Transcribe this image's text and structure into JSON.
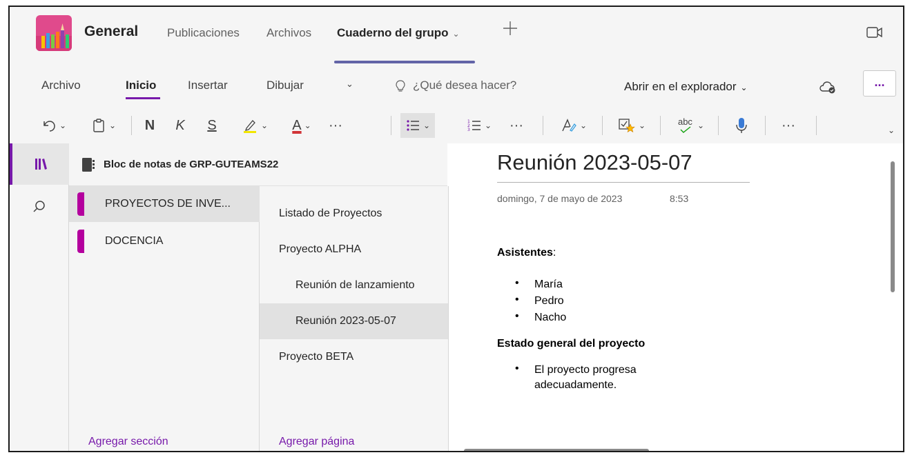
{
  "header": {
    "channel": "General",
    "tabs": [
      {
        "label": "Publicaciones"
      },
      {
        "label": "Archivos"
      },
      {
        "label": "Cuaderno del grupo",
        "active": true
      }
    ],
    "tab_dropdown_icon": "chevron-down-icon",
    "add_tab_icon": "plus-icon",
    "meet_icon": "video-camera-icon"
  },
  "ribbon": {
    "tabs": [
      "Archivo",
      "Inicio",
      "Insertar",
      "Dibujar"
    ],
    "active_tab": "Inicio",
    "tellme_placeholder": "¿Qué desea hacer?",
    "open_in_explorer": "Abrir en el explorador",
    "more_label": "...",
    "toolbar": {
      "bold": "N",
      "italic": "K",
      "underline": "S",
      "font_color_letter": "A",
      "more": "···",
      "spell_label": "abc",
      "highlight_color": "#f2e600",
      "font_color": "#d13438"
    }
  },
  "navigation": {
    "notebook_name": "Bloc de notas de GRP-GUTEAMS22",
    "sections": [
      {
        "label": "PROYECTOS DE INVE...",
        "color": "#b4009e",
        "selected": true
      },
      {
        "label": "DOCENCIA",
        "color": "#b4009e",
        "selected": false
      }
    ],
    "pages": [
      {
        "label": "Listado de Proyectos",
        "level": 0,
        "selected": false
      },
      {
        "label": "Proyecto ALPHA",
        "level": 0,
        "selected": false
      },
      {
        "label": "Reunión de lanzamiento",
        "level": 1,
        "selected": false
      },
      {
        "label": "Reunión 2023-05-07",
        "level": 1,
        "selected": true
      },
      {
        "label": "Proyecto BETA",
        "level": 0,
        "selected": false
      }
    ],
    "add_section": "Agregar sección",
    "add_page": "Agregar página"
  },
  "page": {
    "title": "Reunión 2023-05-07",
    "date": "domingo, 7 de mayo de 2023",
    "time": "8:53",
    "attendees_heading": "Asistentes",
    "attendees_suffix": ":",
    "attendees": [
      "María",
      "Pedro",
      "Nacho"
    ],
    "status_heading": "Estado general del proyecto",
    "status_items": [
      "El proyecto progresa adecuadamente."
    ],
    "status_lines": [
      "El proyecto progresa",
      "adecuadamente."
    ]
  },
  "colors": {
    "teams_accent": "#6264a7",
    "onenote_accent": "#7719aa",
    "section_color": "#b4009e"
  }
}
